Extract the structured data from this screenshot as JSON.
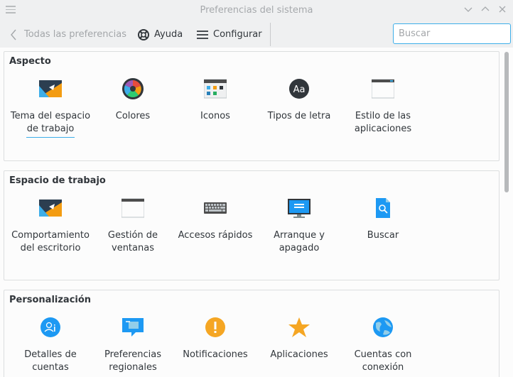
{
  "window": {
    "title": "Preferencias del sistema"
  },
  "toolbar": {
    "back_label": "Todas las preferencias",
    "help_label": "Ayuda",
    "configure_label": "Configurar",
    "search_placeholder": "Buscar"
  },
  "categories": [
    {
      "title": "Aspecto",
      "items": [
        {
          "label": "Tema del espacio de trabajo",
          "icon": "workspace-theme-icon"
        },
        {
          "label": "Colores",
          "icon": "colors-icon"
        },
        {
          "label": "Iconos",
          "icon": "icons-icon"
        },
        {
          "label": "Tipos de letra",
          "icon": "fonts-icon"
        },
        {
          "label": "Estilo de las aplicaciones",
          "icon": "application-style-icon"
        }
      ]
    },
    {
      "title": "Espacio de trabajo",
      "items": [
        {
          "label": "Comportamiento del escritorio",
          "icon": "desktop-behavior-icon"
        },
        {
          "label": "Gestión de ventanas",
          "icon": "window-management-icon"
        },
        {
          "label": "Accesos rápidos",
          "icon": "keyboard-shortcuts-icon"
        },
        {
          "label": "Arranque y apagado",
          "icon": "startup-shutdown-icon"
        },
        {
          "label": "Buscar",
          "icon": "search-file-icon"
        }
      ]
    },
    {
      "title": "Personalización",
      "items": [
        {
          "label": "Detalles de cuentas",
          "icon": "account-details-icon"
        },
        {
          "label": "Preferencias regionales",
          "icon": "regional-settings-icon"
        },
        {
          "label": "Notificaciones",
          "icon": "notifications-icon"
        },
        {
          "label": "Aplicaciones",
          "icon": "applications-star-icon"
        },
        {
          "label": "Cuentas con conexión",
          "icon": "online-accounts-icon"
        }
      ]
    }
  ],
  "colors": {
    "accent": "#3daee9",
    "background": "#eff0f1",
    "content": "#fcfcfc",
    "text": "#31363b"
  }
}
